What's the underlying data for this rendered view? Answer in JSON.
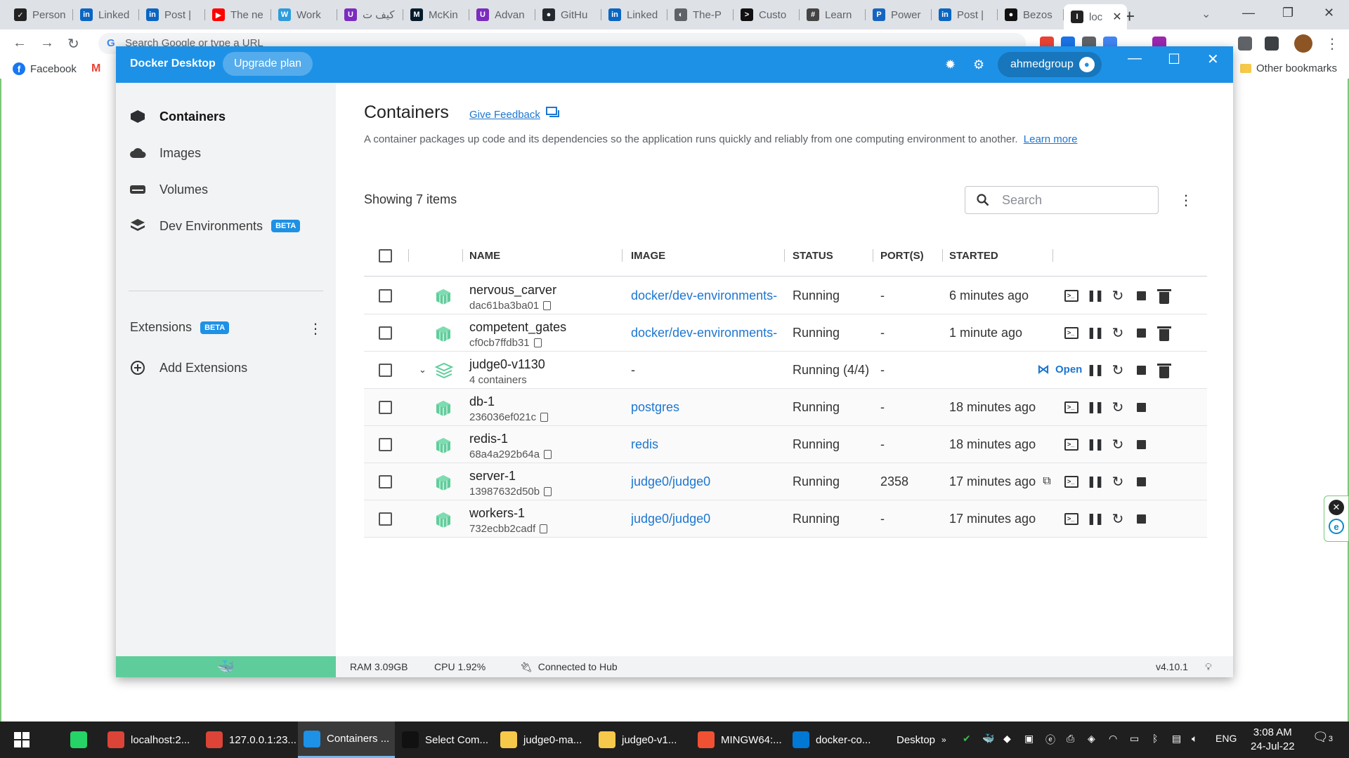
{
  "browser": {
    "tabs": [
      {
        "label": "Person",
        "color": "#222222",
        "glyph": "✓"
      },
      {
        "label": "Linked",
        "color": "#0a66c2",
        "glyph": "in"
      },
      {
        "label": "Post |",
        "color": "#0a66c2",
        "glyph": "in"
      },
      {
        "label": "The ne",
        "color": "#ff0000",
        "glyph": "▶"
      },
      {
        "label": "Work",
        "color": "#2d9cdb",
        "glyph": "W"
      },
      {
        "label": "كيف ت",
        "color": "#7b2cbf",
        "glyph": "U"
      },
      {
        "label": "McKin",
        "color": "#051c2c",
        "glyph": "M"
      },
      {
        "label": "Advan",
        "color": "#7b2cbf",
        "glyph": "U"
      },
      {
        "label": "GitHu",
        "color": "#24292f",
        "glyph": "●"
      },
      {
        "label": "Linked",
        "color": "#0a66c2",
        "glyph": "in"
      },
      {
        "label": "The-P",
        "color": "#5f6368",
        "glyph": "◐"
      },
      {
        "label": "Custo",
        "color": "#111111",
        "glyph": ">"
      },
      {
        "label": "Learn",
        "color": "#444444",
        "glyph": "#"
      },
      {
        "label": "Power",
        "color": "#1565c0",
        "glyph": "P"
      },
      {
        "label": "Post |",
        "color": "#0a66c2",
        "glyph": "in"
      },
      {
        "label": "Bezos",
        "color": "#111111",
        "glyph": "●"
      }
    ],
    "active_tab": {
      "label": "loc",
      "glyph": "I"
    },
    "omnibox_placeholder": "Search Google or type a URL",
    "bookmarks": [
      {
        "label": "Facebook",
        "color": "#1877f2",
        "glyph": "f"
      },
      {
        "label": "",
        "color": "#ea4335",
        "glyph": "M"
      }
    ],
    "other_bookmarks": "Other bookmarks"
  },
  "docker": {
    "app_title": "Docker Desktop",
    "upgrade_label": "Upgrade plan",
    "username": "ahmedgroup",
    "sidebar": {
      "items": [
        {
          "label": "Containers",
          "icon": "containers-icon",
          "active": true
        },
        {
          "label": "Images",
          "icon": "images-icon",
          "active": false
        },
        {
          "label": "Volumes",
          "icon": "volumes-icon",
          "active": false
        },
        {
          "label": "Dev Environments",
          "icon": "dev-environments-icon",
          "badge": "BETA",
          "active": false
        }
      ],
      "extensions_label": "Extensions",
      "extensions_badge": "BETA",
      "add_extensions_label": "Add Extensions"
    },
    "main": {
      "title": "Containers",
      "feedback_label": "Give Feedback",
      "description": "A container packages up code and its dependencies so the application runs quickly and reliably from one computing environment to another.",
      "learn_more": "Learn more",
      "showing": "Showing 7 items",
      "search_placeholder": "Search",
      "columns": [
        "NAME",
        "IMAGE",
        "STATUS",
        "PORT(S)",
        "STARTED"
      ],
      "open_label": "Open",
      "rows": [
        {
          "name": "nervous_carver",
          "id": "dac61ba3ba01",
          "image": "docker/dev-environments-",
          "status": "Running",
          "port": "-",
          "started": "6 minutes ago",
          "kind": "container",
          "delete": true
        },
        {
          "name": "competent_gates",
          "id": "cf0cb7ffdb31",
          "image": "docker/dev-environments-",
          "status": "Running",
          "port": "-",
          "started": "1 minute ago",
          "kind": "container",
          "delete": true
        },
        {
          "name": "judge0-v1130",
          "id": "4 containers",
          "image": "-",
          "status": "Running (4/4)",
          "port": "-",
          "started": "",
          "kind": "group",
          "delete": true
        },
        {
          "name": "db-1",
          "id": "236036ef021c",
          "image": "postgres",
          "status": "Running",
          "port": "-",
          "started": "18 minutes ago",
          "kind": "child",
          "delete": false
        },
        {
          "name": "redis-1",
          "id": "68a4a292b64a",
          "image": "redis",
          "status": "Running",
          "port": "-",
          "started": "18 minutes ago",
          "kind": "child",
          "delete": false
        },
        {
          "name": "server-1",
          "id": "13987632d50b",
          "image": "judge0/judge0",
          "status": "Running",
          "port": "2358",
          "started": "17 minutes ago",
          "kind": "child",
          "delete": false,
          "external_link": true
        },
        {
          "name": "workers-1",
          "id": "732ecbb2cadf",
          "image": "judge0/judge0",
          "status": "Running",
          "port": "-",
          "started": "17 minutes ago",
          "kind": "child",
          "delete": false
        }
      ]
    },
    "statusbar": {
      "ram": "RAM 3.09GB",
      "cpu": "CPU 1.92%",
      "hub": "Connected to Hub",
      "version": "v4.10.1"
    },
    "colors": {
      "accent": "#1d91e6",
      "container": "#5fcd9b",
      "link": "#1d76d1"
    }
  },
  "taskbar": {
    "items": [
      {
        "label": "",
        "color": "#25d366"
      },
      {
        "label": "localhost:2...",
        "color": "#db4437"
      },
      {
        "label": "127.0.0.1:23...",
        "color": "#db4437"
      },
      {
        "label": "Containers ...",
        "color": "#1d91e6",
        "active": true
      },
      {
        "label": "Select Com...",
        "color": "#111111"
      },
      {
        "label": "judge0-ma...",
        "color": "#f6c94a"
      },
      {
        "label": "judge0-v1...",
        "color": "#f6c94a"
      },
      {
        "label": "MINGW64:...",
        "color": "#f05133"
      },
      {
        "label": "docker-co...",
        "color": "#0078d4"
      }
    ],
    "desktop_label": "Desktop",
    "language": "ENG",
    "time": "3:08 AM",
    "date": "24-Jul-22",
    "notifications": "3"
  }
}
